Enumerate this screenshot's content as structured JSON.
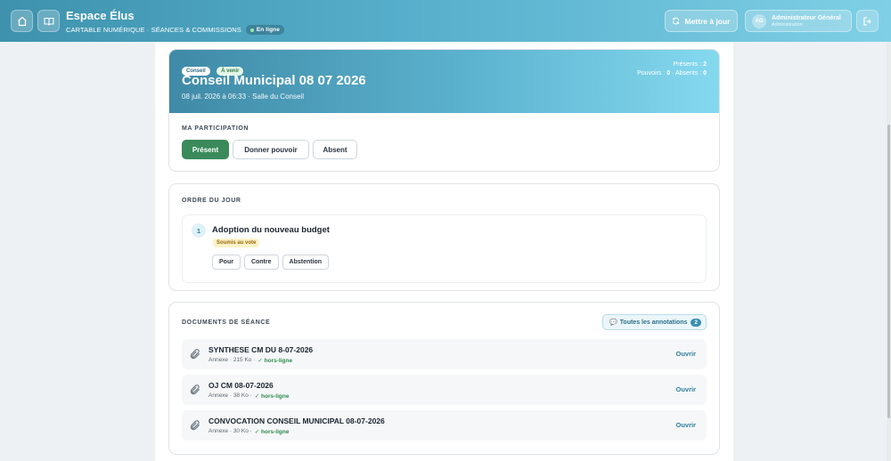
{
  "header": {
    "app_title": "Espace Élus",
    "subtitle": "CARTABLE NUMÉRIQUE · SÉANCES & COMMISSIONS",
    "online_label": "En ligne",
    "update_label": "Mettre à jour",
    "user": {
      "initials": "AG",
      "name": "Administrateur Général",
      "role": "Administration"
    }
  },
  "session": {
    "type_badge": "Conseil",
    "status_badge": "À venir",
    "title": "Conseil Municipal 08 07 2026",
    "date_place": "08 juil. 2026 à 06:33 · Salle du Conseil",
    "stats": {
      "presents_label": "Présents :",
      "presents_value": "2",
      "pouvoirs_label": "Pouvoirs :",
      "pouvoirs_value": "0",
      "absents_label": "· Absents :",
      "absents_value": "0"
    }
  },
  "participation": {
    "label": "MA PARTICIPATION",
    "buttons": [
      "Présent",
      "Donner pouvoir",
      "Absent"
    ],
    "selected": "Présent"
  },
  "agenda": {
    "label": "ORDRE DU JOUR",
    "items": [
      {
        "number": "1",
        "title": "Adoption du nouveau budget",
        "badge": "Soumis au vote",
        "vote_options": [
          "Pour",
          "Contre",
          "Abstention"
        ]
      }
    ]
  },
  "documents": {
    "label": "DOCUMENTS DE SÉANCE",
    "annotations_label": "Toutes les annotations",
    "annotations_count": "2",
    "open_label": "Ouvrir",
    "offline_label": "✓ hors-ligne",
    "items": [
      {
        "name": "SYNTHESE CM DU 8-07-2026",
        "meta": "Annexe · 215 Ko ·"
      },
      {
        "name": "OJ CM 08-07-2026",
        "meta": "Annexe · 38 Ko ·"
      },
      {
        "name": "CONVOCATION CONSEIL MUNICIPAL 08-07-2026",
        "meta": "Annexe · 30 Ko ·"
      }
    ]
  },
  "colors": {
    "accent": "#4aa3c2",
    "present_green": "#3a8a5a",
    "offline_green": "#2f8a4d",
    "vote_badge_bg": "#fdf1c9"
  },
  "icons": {
    "home": "home-icon",
    "book": "book-icon",
    "refresh": "refresh-icon",
    "logout": "logout-icon",
    "attachment": "paperclip-icon",
    "comment": "speech-bubble-icon"
  }
}
